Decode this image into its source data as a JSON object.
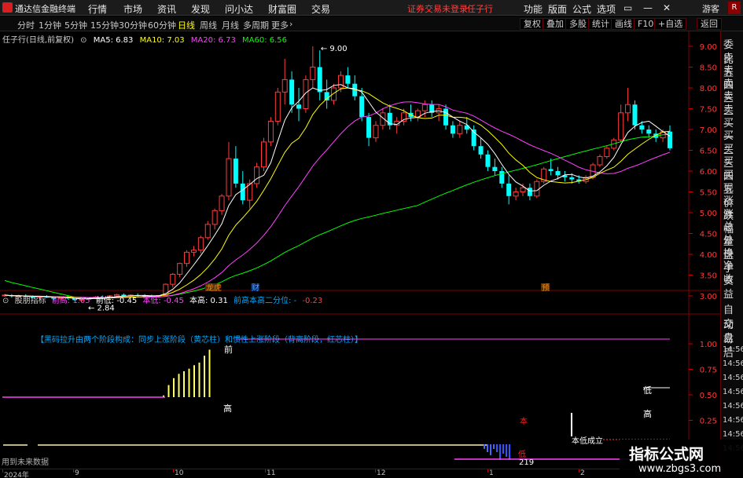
{
  "app": {
    "title": "通达信金融终端",
    "menu": [
      "行情",
      "市场",
      "资讯",
      "发现",
      "问小达",
      "财富圈",
      "交易"
    ],
    "status": "证券交易未登录",
    "stock_name": "任子行",
    "right_menu": [
      "功能",
      "版面",
      "公式",
      "选项"
    ],
    "guest": "游客",
    "corner": "R"
  },
  "periods": [
    "分时",
    "1分钟",
    "5分钟",
    "15分钟",
    "30分钟",
    "60分钟",
    "日线",
    "周线",
    "月线",
    "多周期",
    "更多"
  ],
  "active_period": "日线",
  "toolbar": [
    "复权",
    "叠加",
    "多股",
    "统计",
    "画线",
    "F10",
    "+自选",
    "返回"
  ],
  "chart": {
    "title": "任子行(日线,前复权)",
    "ma5": "MA5: 6.83",
    "ma10": "MA10: 7.03",
    "ma20": "MA20: 6.73",
    "ma60": "MA60: 6.56",
    "high_label": "9.00",
    "low_label": "2.84",
    "event_labels": [
      "龙虎",
      "财",
      "预"
    ],
    "colors": {
      "up": "#ff3b3b",
      "down": "#00ffff",
      "ma5": "#ffffff",
      "ma10": "#ffff00",
      "ma20": "#ff40ff",
      "ma60": "#00ff00"
    }
  },
  "price_axis": [
    "9.00",
    "8.50",
    "8.00",
    "7.50",
    "7.00",
    "6.50",
    "6.00",
    "5.50",
    "5.00",
    "4.50",
    "4.00",
    "3.50",
    "3.00"
  ],
  "indicator": {
    "name": "股朋指标",
    "qiangao": "前高: 1.05",
    "qiandi": "前低: -0.45",
    "bendi": "本低: -0.45",
    "bengao": "本高: 0.31",
    "fenwei": "前高本高二分位: -",
    "fenwei2": "-0.23",
    "banner": "【黑码拉升由两个阶段构成：同步上涨阶段（黄芯柱）和惯性上涨阶段（背离阶段，红芯柱）】",
    "axis": [
      "1.00",
      "0.75",
      "0.50",
      "0.25"
    ],
    "labels": {
      "qian": "前",
      "gao": "高",
      "ben": "本",
      "di": "低",
      "ben_di_cheng_li": "本低成立",
      "value": "219",
      "bottom": "用到未来数据"
    }
  },
  "dates": [
    "2024年",
    "9",
    "10",
    "11",
    "12",
    "1",
    "2"
  ],
  "right_panel": [
    "委比",
    "卖五",
    "卖四",
    "卖三",
    "卖二",
    "卖一",
    "买一",
    "买二",
    "买三",
    "买四",
    "买五",
    "现价",
    "涨跌",
    "涨幅",
    "总量",
    "外盘",
    "换手",
    "净资",
    "收益",
    "自动",
    "交易",
    "盘后",
    "14:56",
    "14:56",
    "14:56",
    "14:56",
    "14:56",
    "14:56",
    "14:56",
    "14:56"
  ],
  "watermark": {
    "title": "指标公式网",
    "url": "www.zbgs3.com"
  },
  "candles": [
    [
      3.02,
      3.05,
      2.98,
      3.02
    ],
    [
      3.02,
      3.04,
      2.96,
      2.99
    ],
    [
      2.99,
      3.03,
      2.95,
      3.0
    ],
    [
      3.0,
      3.04,
      2.97,
      2.98
    ],
    [
      2.98,
      3.01,
      2.94,
      2.97
    ],
    [
      2.97,
      3.0,
      2.93,
      2.99
    ],
    [
      2.99,
      3.02,
      2.95,
      2.96
    ],
    [
      2.96,
      2.99,
      2.9,
      2.93
    ],
    [
      2.93,
      2.98,
      2.9,
      2.96
    ],
    [
      2.96,
      3.0,
      2.92,
      2.94
    ],
    [
      2.94,
      2.97,
      2.88,
      2.9
    ],
    [
      2.9,
      2.94,
      2.84,
      2.92
    ],
    [
      2.92,
      2.97,
      2.89,
      2.95
    ],
    [
      2.95,
      3.0,
      2.92,
      2.97
    ],
    [
      2.97,
      3.01,
      2.93,
      2.96
    ],
    [
      2.96,
      3.02,
      2.94,
      3.0
    ],
    [
      3.0,
      3.05,
      2.97,
      3.03
    ],
    [
      3.03,
      3.06,
      2.98,
      3.0
    ],
    [
      3.0,
      3.04,
      2.96,
      3.02
    ],
    [
      3.02,
      3.06,
      2.99,
      3.01
    ],
    [
      3.01,
      3.04,
      2.97,
      3.0
    ],
    [
      3.0,
      3.03,
      2.96,
      2.98
    ],
    [
      2.98,
      3.02,
      2.95,
      3.01
    ],
    [
      3.01,
      3.3,
      3.0,
      3.28
    ],
    [
      3.28,
      3.55,
      3.2,
      3.52
    ],
    [
      3.52,
      3.8,
      3.45,
      3.78
    ],
    [
      3.78,
      4.1,
      3.7,
      4.05
    ],
    [
      4.05,
      4.2,
      3.95,
      4.1
    ],
    [
      4.1,
      4.45,
      4.02,
      4.4
    ],
    [
      4.4,
      4.8,
      4.35,
      4.72
    ],
    [
      4.72,
      5.1,
      4.6,
      5.05
    ],
    [
      5.05,
      5.45,
      4.95,
      5.4
    ],
    [
      5.4,
      6.7,
      5.3,
      6.3
    ],
    [
      6.3,
      6.6,
      5.6,
      5.7
    ],
    [
      5.7,
      6.0,
      5.2,
      5.3
    ],
    [
      5.3,
      5.8,
      5.1,
      5.7
    ],
    [
      5.7,
      6.2,
      5.6,
      6.1
    ],
    [
      6.1,
      6.8,
      6.0,
      6.7
    ],
    [
      6.7,
      7.3,
      6.6,
      7.2
    ],
    [
      7.2,
      8.0,
      7.1,
      7.9
    ],
    [
      7.9,
      8.7,
      7.6,
      8.2
    ],
    [
      8.2,
      8.4,
      7.4,
      7.6
    ],
    [
      7.6,
      8.0,
      7.2,
      7.5
    ],
    [
      7.5,
      8.3,
      7.4,
      8.2
    ],
    [
      8.2,
      9.0,
      8.0,
      8.5
    ],
    [
      8.5,
      8.9,
      7.7,
      7.9
    ],
    [
      7.9,
      8.2,
      7.5,
      7.7
    ],
    [
      7.7,
      8.1,
      7.6,
      8.0
    ],
    [
      8.0,
      8.4,
      7.9,
      8.3
    ],
    [
      8.3,
      8.5,
      8.0,
      8.1
    ],
    [
      8.1,
      8.3,
      7.7,
      7.8
    ],
    [
      7.8,
      8.0,
      7.2,
      7.3
    ],
    [
      7.3,
      7.4,
      6.6,
      6.8
    ],
    [
      6.8,
      7.2,
      6.7,
      7.1
    ],
    [
      7.1,
      7.5,
      7.0,
      7.4
    ],
    [
      7.4,
      7.6,
      7.0,
      7.1
    ],
    [
      7.1,
      7.3,
      6.9,
      7.2
    ],
    [
      7.2,
      7.5,
      7.1,
      7.4
    ],
    [
      7.4,
      7.6,
      7.2,
      7.3
    ],
    [
      7.3,
      7.5,
      7.2,
      7.45
    ],
    [
      7.45,
      7.7,
      7.3,
      7.6
    ],
    [
      7.6,
      7.7,
      7.3,
      7.4
    ],
    [
      7.4,
      7.6,
      7.2,
      7.5
    ],
    [
      7.5,
      7.6,
      7.0,
      7.1
    ],
    [
      7.1,
      7.2,
      6.8,
      6.9
    ],
    [
      6.9,
      7.2,
      6.8,
      7.1
    ],
    [
      7.1,
      7.3,
      6.9,
      7.0
    ],
    [
      7.0,
      7.1,
      6.5,
      6.6
    ],
    [
      6.6,
      6.8,
      6.3,
      6.4
    ],
    [
      6.4,
      6.5,
      6.0,
      6.1
    ],
    [
      6.1,
      6.3,
      5.9,
      6.0
    ],
    [
      6.0,
      6.1,
      5.6,
      5.7
    ],
    [
      5.7,
      5.9,
      5.2,
      5.4
    ],
    [
      5.4,
      5.6,
      5.3,
      5.5
    ],
    [
      5.5,
      5.7,
      5.4,
      5.6
    ],
    [
      5.6,
      5.7,
      5.3,
      5.4
    ],
    [
      5.4,
      5.8,
      5.35,
      5.75
    ],
    [
      5.75,
      6.1,
      5.7,
      6.05
    ],
    [
      6.05,
      6.3,
      5.9,
      6.0
    ],
    [
      6.0,
      6.1,
      5.8,
      5.9
    ],
    [
      5.9,
      6.0,
      5.75,
      5.85
    ],
    [
      5.85,
      5.95,
      5.7,
      5.8
    ],
    [
      5.8,
      5.9,
      5.7,
      5.75
    ],
    [
      5.75,
      5.9,
      5.7,
      5.85
    ],
    [
      5.85,
      6.2,
      5.8,
      6.15
    ],
    [
      6.15,
      6.4,
      6.1,
      6.35
    ],
    [
      6.35,
      6.6,
      6.3,
      6.55
    ],
    [
      6.55,
      6.8,
      6.5,
      6.75
    ],
    [
      6.75,
      7.6,
      6.7,
      7.4
    ],
    [
      7.4,
      8.0,
      7.2,
      7.6
    ],
    [
      7.6,
      7.7,
      7.0,
      7.1
    ],
    [
      7.1,
      7.2,
      6.9,
      7.0
    ],
    [
      7.0,
      7.1,
      6.8,
      6.9
    ],
    [
      6.9,
      7.0,
      6.7,
      6.8
    ],
    [
      6.8,
      7.0,
      6.7,
      6.95
    ],
    [
      6.95,
      7.1,
      6.5,
      6.55
    ]
  ]
}
